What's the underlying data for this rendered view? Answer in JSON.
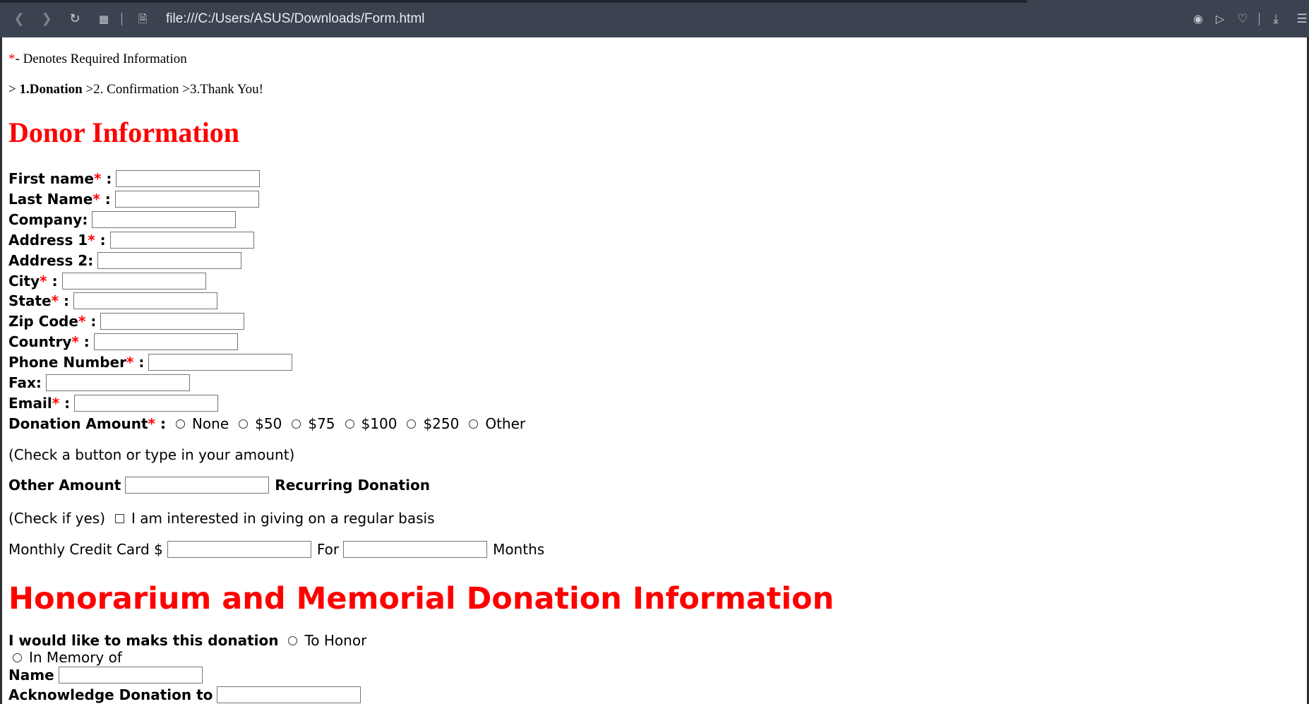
{
  "browser": {
    "url": "file:///C:/Users/ASUS/Downloads/Form.html"
  },
  "page": {
    "required_marker": "*",
    "required_legend": "- Denotes Required Information",
    "steps": {
      "prefix": ">",
      "step1": "1.Donation",
      "step2": ">2. Confirmation",
      "step3": ">3.Thank You!"
    },
    "donor_heading": "Donor Information",
    "fields": {
      "first_name": "First name",
      "last_name": "Last Name",
      "company": "Company:",
      "address1": "Address 1",
      "address2": "Address 2:",
      "city": "City",
      "state": "State",
      "zip": "Zip Code",
      "country": "Country",
      "phone": "Phone Number",
      "fax": "Fax:",
      "email": "Email"
    },
    "colon": ":",
    "donation": {
      "label": "Donation Amount",
      "options": [
        "None",
        "$50",
        "$75",
        "$100",
        "$250",
        "Other"
      ],
      "hint": "(Check a button or type in your amount)",
      "other_amount_label": "Other Amount",
      "recurring_label": "Recurring Donation",
      "check_if_yes": "(Check if yes)",
      "regular_basis": "I am interested in giving on a regular basis",
      "monthly_label": "Monthly Credit Card $",
      "for_label": "For",
      "months_label": "Months"
    },
    "honor_heading": "Honorarium and Memorial Donation Information",
    "honor": {
      "intro": "I would like to maks this donation",
      "to_honor": "To Honor",
      "in_memory": "In Memory of",
      "name_label": "Name",
      "acknowledge_label": "Acknowledge Donation to"
    }
  }
}
